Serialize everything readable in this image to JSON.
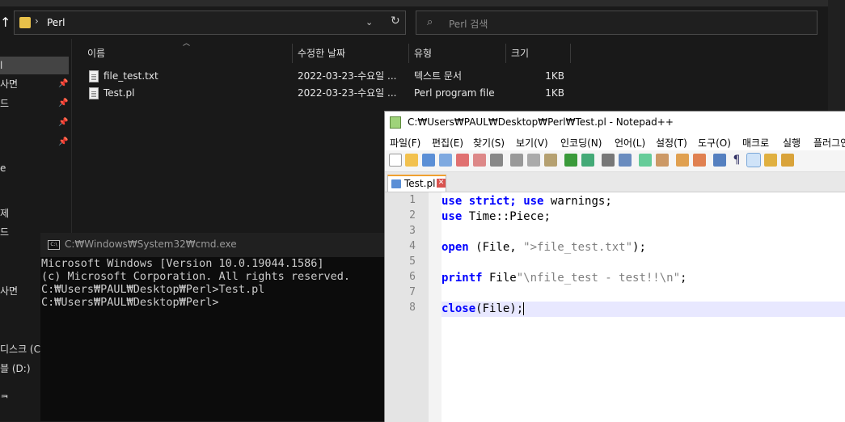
{
  "explorer": {
    "address": {
      "path": "Perl"
    },
    "search": {
      "placeholder": "Perl 검색"
    },
    "nav_items": [
      {
        "label": "l",
        "pinned": false,
        "selected": true
      },
      {
        "label": "사면",
        "pinned": true
      },
      {
        "label": "드",
        "pinned": true
      },
      {
        "label": "",
        "pinned": true
      },
      {
        "label": "",
        "pinned": true
      },
      {
        "label": "e",
        "pinned": false
      },
      {
        "label": "제",
        "pinned": false
      },
      {
        "label": "드",
        "pinned": false
      },
      {
        "label": "사면",
        "pinned": false
      },
      {
        "label": "디스크 (C:)",
        "pinned": false
      },
      {
        "label": "블 (D:)",
        "pinned": false
      },
      {
        "label": "ᆿ",
        "pinned": false
      }
    ],
    "columns": [
      "이름",
      "수정한 날짜",
      "유형",
      "크기"
    ],
    "files": [
      {
        "name": "file_test.txt",
        "date": "2022-03-23-수요일 ...",
        "type": "텍스트 문서",
        "size": "1KB"
      },
      {
        "name": "Test.pl",
        "date": "2022-03-23-수요일 ...",
        "type": "Perl program file",
        "size": "1KB"
      }
    ]
  },
  "cmd": {
    "title": "C:₩Windows₩System32₩cmd.exe",
    "icon_text": "C:\\",
    "lines": [
      "Microsoft Windows [Version 10.0.19044.1586]",
      "(c) Microsoft Corporation. All rights reserved.",
      "",
      "C:₩Users₩PAUL₩Desktop₩Perl>Test.pl",
      "",
      "C:₩Users₩PAUL₩Desktop₩Perl>"
    ]
  },
  "notepad": {
    "title": "C:₩Users₩PAUL₩Desktop₩Perl₩Test.pl - Notepad++",
    "menu": [
      "파일(F)",
      "편집(E)",
      "찾기(S)",
      "보기(V)",
      "인코딩(N)",
      "언어(L)",
      "설정(T)",
      "도구(O)",
      "매크로",
      "실행",
      "플러그인"
    ],
    "tab_label": "Test.pl",
    "line_numbers": [
      "1",
      "2",
      "3",
      "4",
      "5",
      "6",
      "7",
      "8"
    ],
    "code": [
      {
        "kw1": "use",
        "t1": " ",
        "kw2": "strict;",
        "t2": " ",
        "kw3": "use",
        "t3": " warnings;"
      },
      {
        "kw1": "use",
        "t1": " Time::Piece;"
      },
      {},
      {
        "kw1": "open",
        "t1": " (File, ",
        "s1": "\">file_test.txt\"",
        "t2": ");"
      },
      {},
      {
        "kw1": "printf",
        "t1": " File",
        "s1": "\"\\nfile_test - test!!\\n\"",
        "t2": ";"
      },
      {},
      {
        "kw1": "close",
        "t1": "(File);"
      }
    ]
  }
}
